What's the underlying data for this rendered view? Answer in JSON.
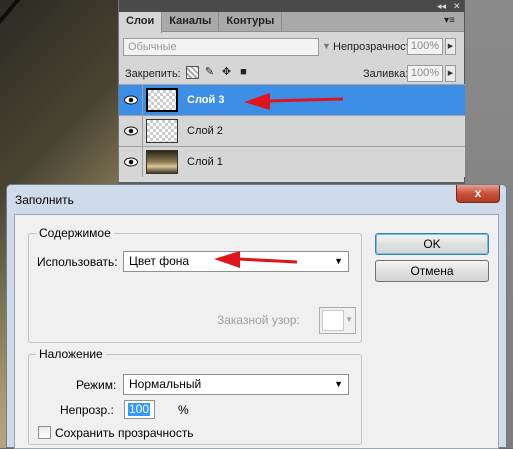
{
  "layers_panel": {
    "topbar": {
      "collapse_glyph": "◂◂",
      "close_glyph": "✕"
    },
    "tabs": [
      {
        "label": "Слои"
      },
      {
        "label": "Каналы"
      },
      {
        "label": "Контуры"
      }
    ],
    "menu_glyph": "▾≡",
    "blend_mode": "Обычные",
    "opacity_label": "Непрозрачность:",
    "opacity_value": "100%",
    "lock_label": "Закрепить:",
    "fill_label": "Заливка:",
    "fill_value": "100%",
    "layers": [
      {
        "name": "Слой 3",
        "selected": true
      },
      {
        "name": "Слой 2",
        "selected": false
      },
      {
        "name": "Слой 1",
        "selected": false
      }
    ]
  },
  "dialog": {
    "title": "Заполнить",
    "close_glyph": "x",
    "contents_group": {
      "title": "Содержимое",
      "use_label": "Использовать:",
      "use_value": "Цвет фона",
      "pattern_label": "Заказной узор:"
    },
    "blending_group": {
      "title": "Наложение",
      "mode_label": "Режим:",
      "mode_value": "Нормальный",
      "opacity_label": "Непрозр.:",
      "opacity_value": "100",
      "opacity_unit": "%",
      "preserve_label": "Сохранить прозрачность"
    },
    "ok_label": "OK",
    "cancel_label": "Отмена"
  },
  "colors": {
    "selection": "#3d8ee6",
    "annotation_arrow": "#e0141c",
    "dialog_frame": "#cfdbe9"
  }
}
